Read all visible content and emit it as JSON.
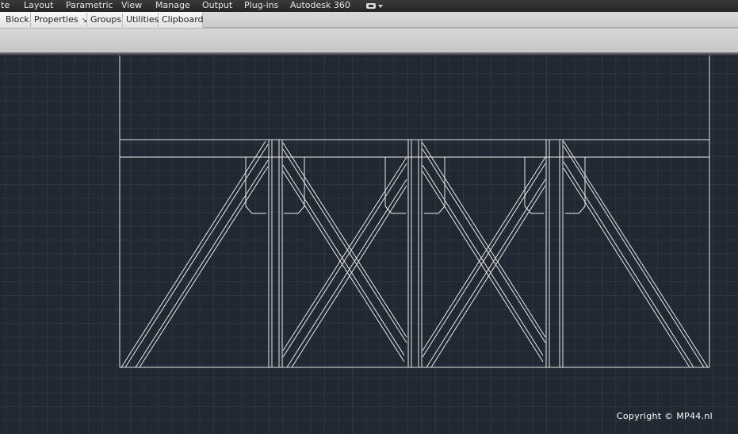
{
  "menubar": {
    "items": [
      "te",
      "Layout",
      "Parametric",
      "View",
      "Manage",
      "Output",
      "Plug-ins",
      "Autodesk 360"
    ],
    "workspace_icon": "workspace-switch-icon"
  },
  "ribbon": {
    "panels": [
      {
        "label": "Block"
      },
      {
        "label": "Properties",
        "launcher": "↘"
      },
      {
        "label": "Groups"
      },
      {
        "label": "Utilities"
      },
      {
        "label": "Clipboard"
      }
    ]
  },
  "drawing": {
    "subject": "truss frame",
    "line_color": "#e8e8e8",
    "grid_color": "#2c3541",
    "background": "#212831"
  },
  "watermark": {
    "text": "Copyright © MP44.nl"
  }
}
